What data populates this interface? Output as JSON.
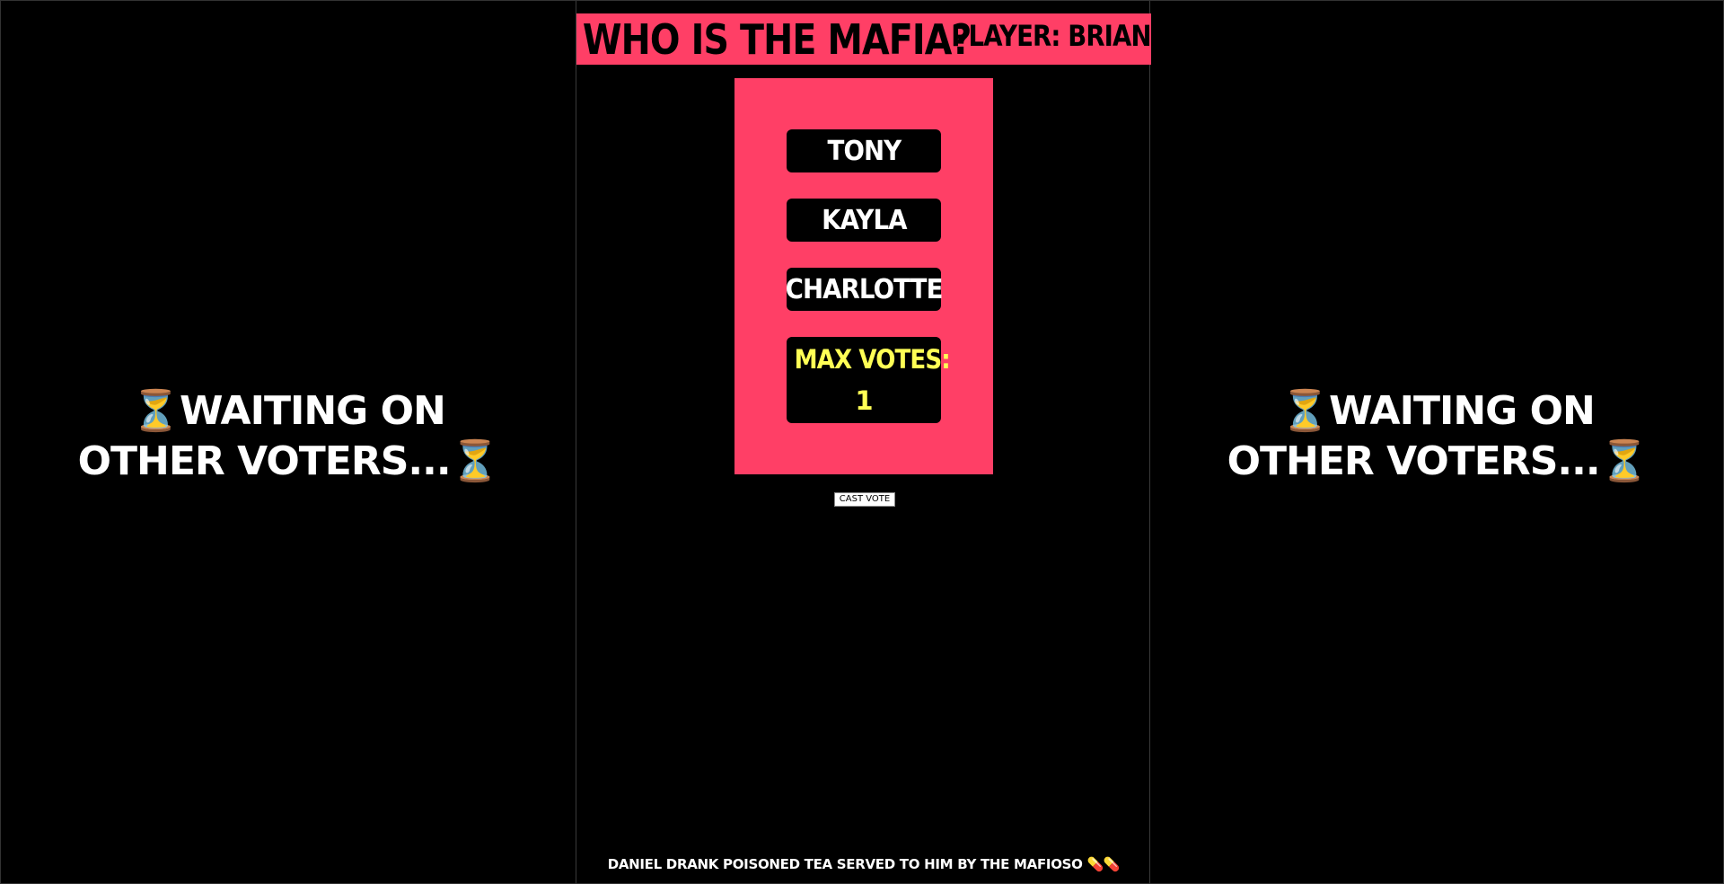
{
  "left_panel": {
    "icon_before": "⏳",
    "text": "Waiting on other voters...",
    "icon_after": "⏳"
  },
  "right_panel": {
    "icon_before": "⏳",
    "text": "Waiting on other voters...",
    "icon_after": "⏳"
  },
  "header": {
    "title": "Who is the mafia?",
    "player": "Player: Brian"
  },
  "vote_options": [
    {
      "label": "Tony"
    },
    {
      "label": "Kayla"
    },
    {
      "label": "Charlotte"
    }
  ],
  "max_votes": {
    "label": "Max votes:",
    "value": "1"
  },
  "cast_vote_label": "Cast vote",
  "event_log": "Daniel drank poisoned tea served to him by the mafioso 💊💊",
  "colors": {
    "accent": "#ff3f66",
    "background": "#000000",
    "max_votes_text": "#ffff55"
  }
}
